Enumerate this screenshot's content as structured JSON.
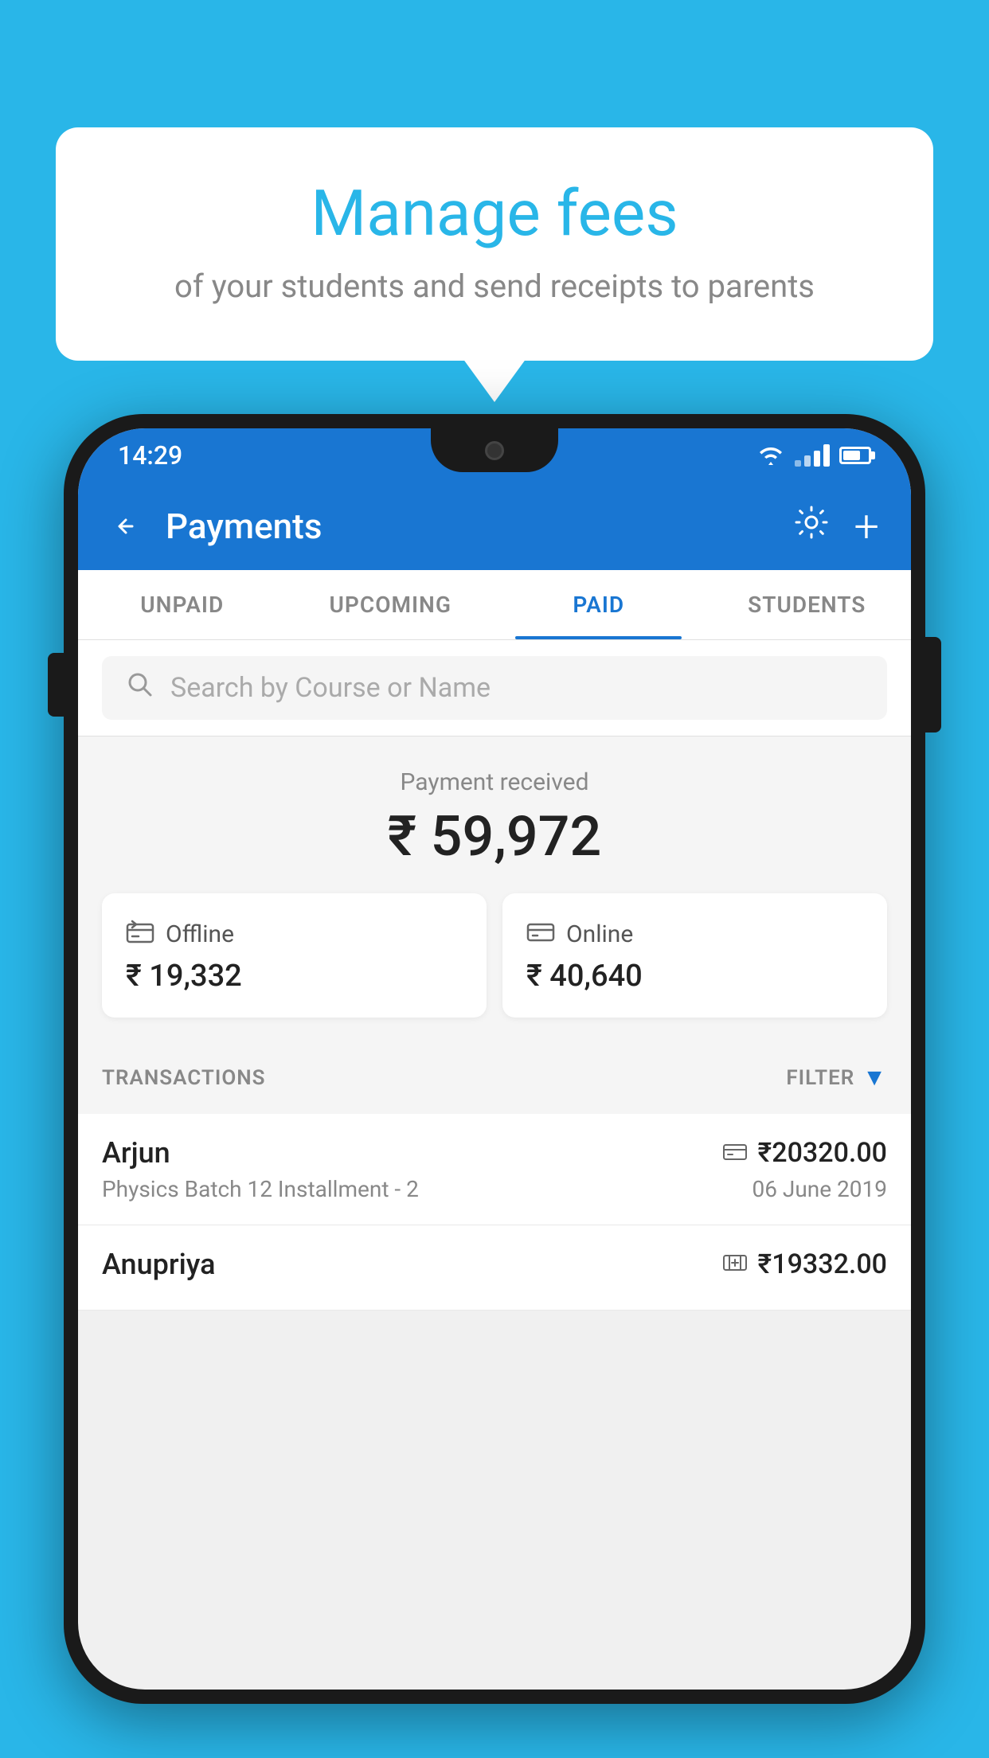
{
  "background_color": "#29B6E8",
  "speech_bubble": {
    "title": "Manage fees",
    "subtitle": "of your students and send receipts to parents"
  },
  "status_bar": {
    "time": "14:29"
  },
  "app_bar": {
    "title": "Payments",
    "back_label": "←",
    "settings_label": "⚙",
    "add_label": "+"
  },
  "tabs": [
    {
      "label": "UNPAID",
      "active": false
    },
    {
      "label": "UPCOMING",
      "active": false
    },
    {
      "label": "PAID",
      "active": true
    },
    {
      "label": "STUDENTS",
      "active": false
    }
  ],
  "search": {
    "placeholder": "Search by Course or Name"
  },
  "payment_summary": {
    "label": "Payment received",
    "amount": "₹ 59,972",
    "offline": {
      "type": "Offline",
      "amount": "₹ 19,332"
    },
    "online": {
      "type": "Online",
      "amount": "₹ 40,640"
    }
  },
  "transactions": {
    "label": "TRANSACTIONS",
    "filter_label": "FILTER",
    "rows": [
      {
        "name": "Arjun",
        "type_icon": "card",
        "amount": "₹20320.00",
        "course": "Physics Batch 12 Installment - 2",
        "date": "06 June 2019"
      },
      {
        "name": "Anupriya",
        "type_icon": "cash",
        "amount": "₹19332.00",
        "course": "",
        "date": ""
      }
    ]
  }
}
